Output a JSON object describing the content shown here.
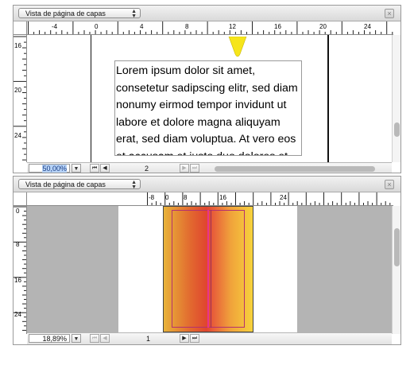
{
  "top_pane": {
    "view_menu_label": "Vista de página de capas",
    "hruler_labels": [
      "-4",
      "0",
      "4",
      "8",
      "12",
      "16",
      "20",
      "24"
    ],
    "vruler_labels": [
      "16",
      "20",
      "24"
    ],
    "lorem_text": "Lorem ipsum dolor sit amet, consetetur sadipscing elitr, sed diam nonumy eirmod tempor invidunt ut labore et dolore magna aliquyam erat, sed diam voluptua. At vero eos et accusam et justo duo dolores et ea rebum.",
    "zoom": "50,00%",
    "page_number": "2"
  },
  "bottom_pane": {
    "view_menu_label": "Vista de página de capas",
    "hruler_labels": [
      "-8",
      "0",
      "8",
      "16",
      "24"
    ],
    "vruler_labels": [
      "0",
      "8",
      "16",
      "24"
    ],
    "zoom": "18,89%",
    "page_number": "1"
  },
  "icons": {
    "close": "close-icon",
    "dropdown": "chevron-down-icon",
    "first_page": "first-page-icon",
    "prev_page": "prev-page-icon",
    "next_page": "next-page-icon",
    "last_page": "last-page-icon"
  },
  "colors": {
    "pasteboard": "#b4b4b4",
    "gradient_orange": "#e2692f",
    "gradient_yellow": "#f7d23c",
    "frame_magenta": "#e8338a",
    "marker_yellow": "#f6e51b"
  }
}
